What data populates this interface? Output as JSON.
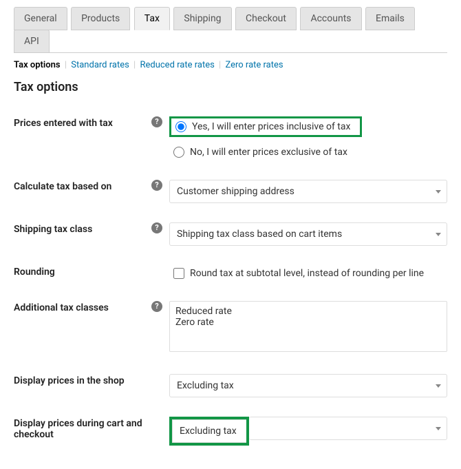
{
  "tabs": {
    "general": "General",
    "products": "Products",
    "tax": "Tax",
    "shipping": "Shipping",
    "checkout": "Checkout",
    "accounts": "Accounts",
    "emails": "Emails",
    "api": "API"
  },
  "subnav": {
    "tax_options": "Tax options",
    "standard_rates": "Standard rates",
    "reduced_rate_rates": "Reduced rate rates",
    "zero_rate_rates": "Zero rate rates"
  },
  "heading": "Tax options",
  "fields": {
    "prices_with_tax": {
      "label": "Prices entered with tax",
      "option_yes": "Yes, I will enter prices inclusive of tax",
      "option_no": "No, I will enter prices exclusive of tax"
    },
    "calc_based_on": {
      "label": "Calculate tax based on",
      "value": "Customer shipping address"
    },
    "shipping_tax_class": {
      "label": "Shipping tax class",
      "value": "Shipping tax class based on cart items"
    },
    "rounding": {
      "label": "Rounding",
      "checkbox_label": "Round tax at subtotal level, instead of rounding per line"
    },
    "additional_tax_classes": {
      "label": "Additional tax classes",
      "value": "Reduced rate\nZero rate"
    },
    "display_shop": {
      "label": "Display prices in the shop",
      "value": "Excluding tax"
    },
    "display_cart": {
      "label": "Display prices during cart and checkout",
      "value": "Excluding tax"
    }
  }
}
